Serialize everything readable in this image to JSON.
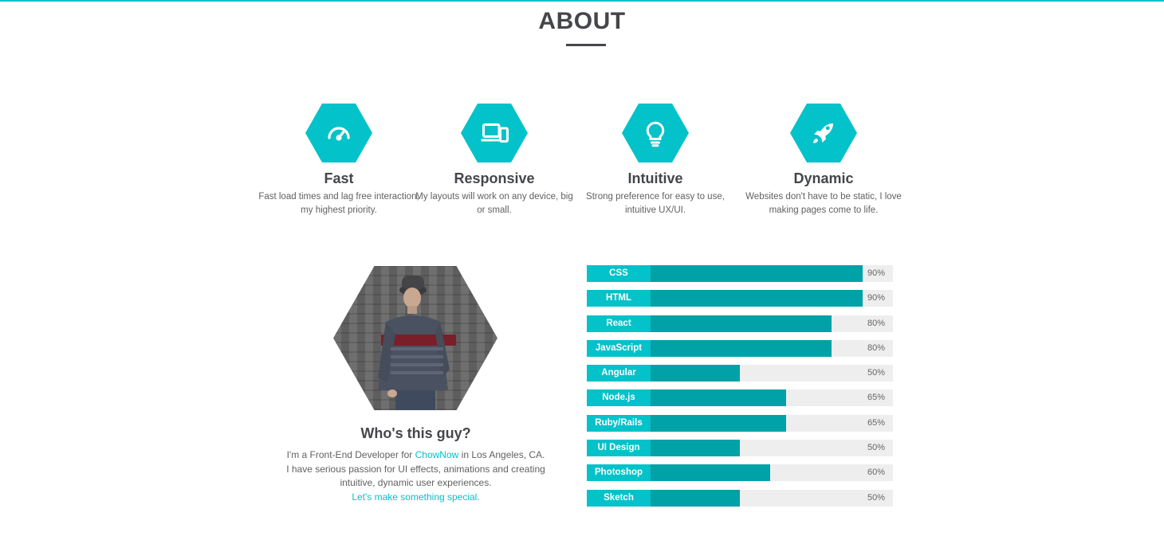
{
  "section": {
    "title": "ABOUT"
  },
  "features": [
    {
      "icon": "speedometer-icon",
      "title": "Fast",
      "text": "Fast load times and lag free interaction, my highest priority."
    },
    {
      "icon": "devices-icon",
      "title": "Responsive",
      "text": "My layouts will work on any device, big or small."
    },
    {
      "icon": "lightbulb-icon",
      "title": "Intuitive",
      "text": "Strong preference for easy to use, intuitive UX/UI."
    },
    {
      "icon": "rocket-icon",
      "title": "Dynamic",
      "text": "Websites don't have to be static, I love making pages come to life."
    }
  ],
  "bio": {
    "title": "Who's this guy?",
    "line1_pre": "I'm a Front-End Developer for ",
    "employer_link": "ChowNow",
    "line1_post": " in Los Angeles, CA.",
    "line2": "I have serious passion for UI effects, animations and creating intuitive, dynamic user experiences.",
    "cta_link": "Let's make something special."
  },
  "skills": [
    {
      "name": "CSS",
      "percent": 90,
      "label": "90%"
    },
    {
      "name": "HTML",
      "percent": 90,
      "label": "90%"
    },
    {
      "name": "React",
      "percent": 80,
      "label": "80%"
    },
    {
      "name": "JavaScript",
      "percent": 80,
      "label": "80%"
    },
    {
      "name": "Angular",
      "percent": 50,
      "label": "50%"
    },
    {
      "name": "Node.js",
      "percent": 65,
      "label": "65%"
    },
    {
      "name": "Ruby/Rails",
      "percent": 65,
      "label": "65%"
    },
    {
      "name": "UI Design",
      "percent": 50,
      "label": "50%"
    },
    {
      "name": "Photoshop",
      "percent": 60,
      "label": "60%"
    },
    {
      "name": "Sketch",
      "percent": 50,
      "label": "50%"
    }
  ],
  "colors": {
    "accent": "#04c2c9",
    "bar_fill": "#00a1a7",
    "bar_track": "#eeeeee",
    "heading": "#444649"
  }
}
